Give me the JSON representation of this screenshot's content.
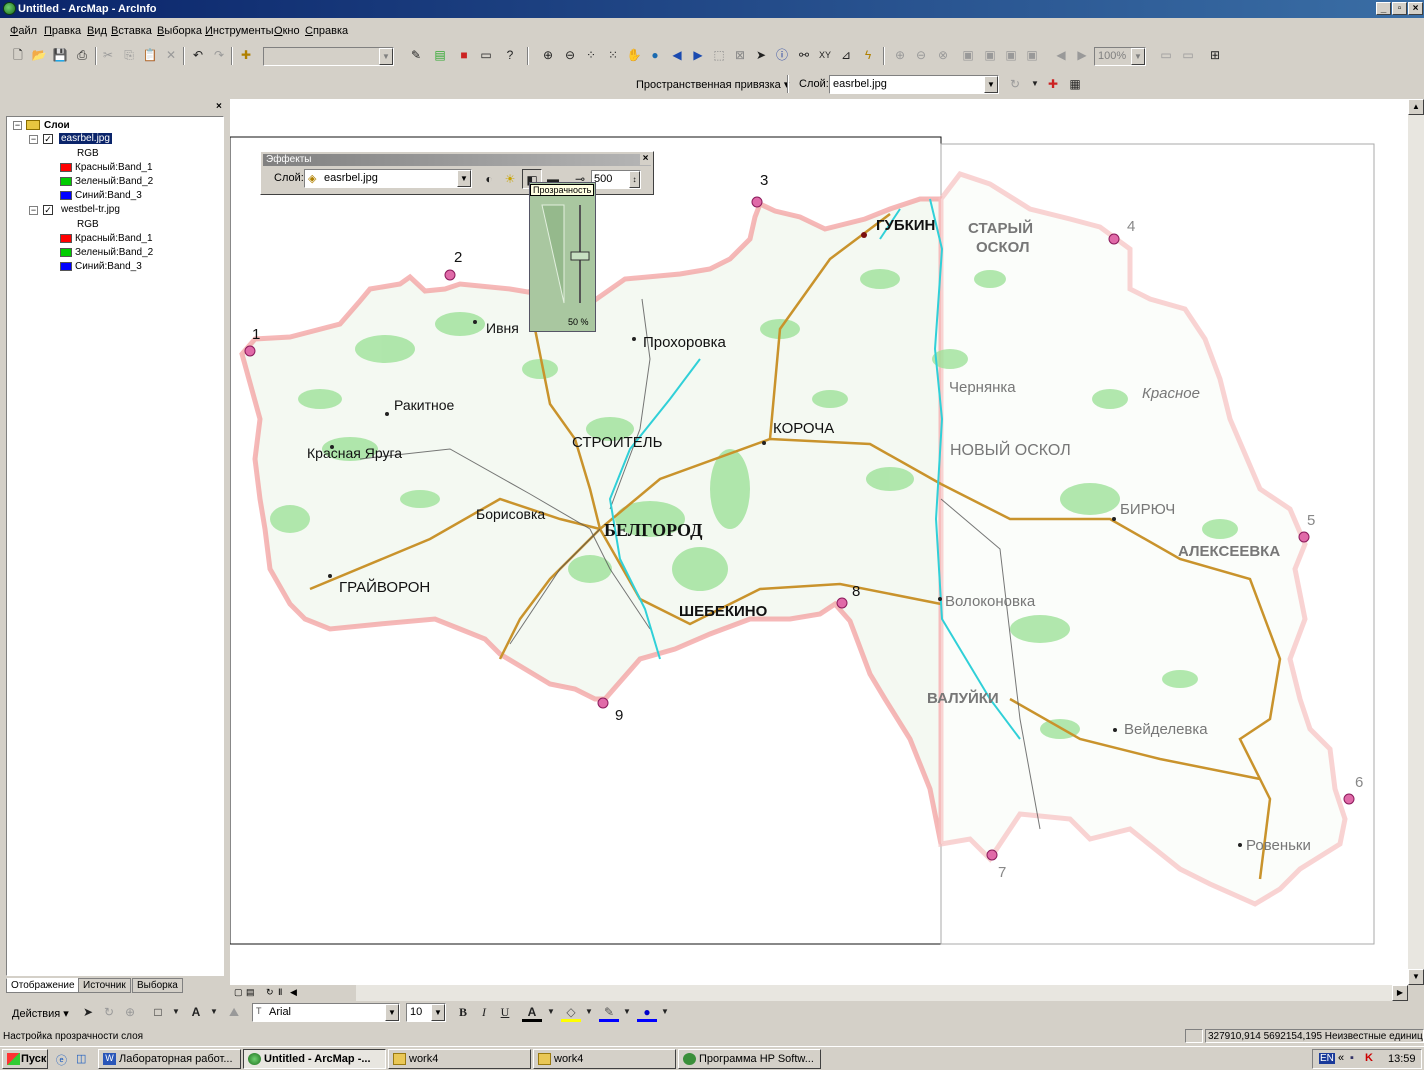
{
  "window": {
    "title": "Untitled - ArcMap - ArcInfo"
  },
  "menu": [
    "Файл",
    "Правка",
    "Вид",
    "Вставка",
    "Выборка",
    "Инструменты",
    "Окно",
    "Справка"
  ],
  "georef_toolbar": {
    "label": "Пространственная привязка ▾",
    "layer_label": "Слой:",
    "layer_value": "easrbel.jpg"
  },
  "standard_toolbar": {
    "scale_value": "",
    "zoom_value": "100%"
  },
  "toc": {
    "root": "Слои",
    "layers": [
      {
        "name": "easrbel.jpg",
        "rgb": "RGB",
        "bands": [
          "Красный:Band_1",
          "Зеленый:Band_2",
          "Синий:Band_3"
        ]
      },
      {
        "name": "westbel-tr.jpg",
        "rgb": "RGB",
        "bands": [
          "Красный:Band_1",
          "Зеленый:Band_2",
          "Синий:Band_3"
        ]
      }
    ],
    "tabs": [
      "Отображение",
      "Источник",
      "Выборка"
    ]
  },
  "effects": {
    "title": "Эффекты",
    "layer_label": "Слой:",
    "layer_value": "easrbel.jpg",
    "value": "500",
    "tooltip": "Прозрачность",
    "transparency_level": "50 %",
    "transparency_fraction": 0.5
  },
  "map": {
    "points": [
      "1",
      "2",
      "3",
      "4",
      "5",
      "6",
      "7",
      "8",
      "9"
    ],
    "labels": {
      "gubkin": "ГУБКИН",
      "stary_oskol_1": "СТАРЫЙ",
      "stary_oskol_2": "ОСКОЛ",
      "ivnya": "Ивня",
      "prokhorovka": "Прохоровка",
      "rakitnoe": "Ракитное",
      "krasnaya_yaruga": "Красная Яруга",
      "stroitel": "СТРОИТЕЛЬ",
      "korocha": "КОРОЧА",
      "chernyanka": "Чернянка",
      "krasnoe": "Красное",
      "novy_oskol": "НОВЫЙ ОСКОЛ",
      "borisovka": "Борисовка",
      "belgorod": "БЕЛГОРОД",
      "biryuch": "БИРЮЧ",
      "alekseevka": "АЛЕКСЕЕВКА",
      "grayvoron": "ГРАЙВОРОН",
      "shebekino": "ШЕБЕКИНО",
      "volokonovka": "Волоконовка",
      "valuyki": "ВАЛУЙКИ",
      "veydelevka": "Вейделевка",
      "rovenki": "Ровеньки"
    }
  },
  "drawing_toolbar": {
    "actions": "Действия ▾",
    "font": "Arial",
    "size": "10",
    "bold": "B",
    "italic": "I",
    "underline": "U"
  },
  "status": {
    "message": "Настройка прозрачности слоя",
    "coords": "327910,914  5692154,195 Неизвестные единиц"
  },
  "taskbar": {
    "start": "Пуск",
    "tasks": [
      "Лабораторная работ...",
      "Untitled - ArcMap -...",
      "work4",
      "work4",
      "Программа HP Softw..."
    ],
    "lang": "EN",
    "clock": "13:59"
  }
}
